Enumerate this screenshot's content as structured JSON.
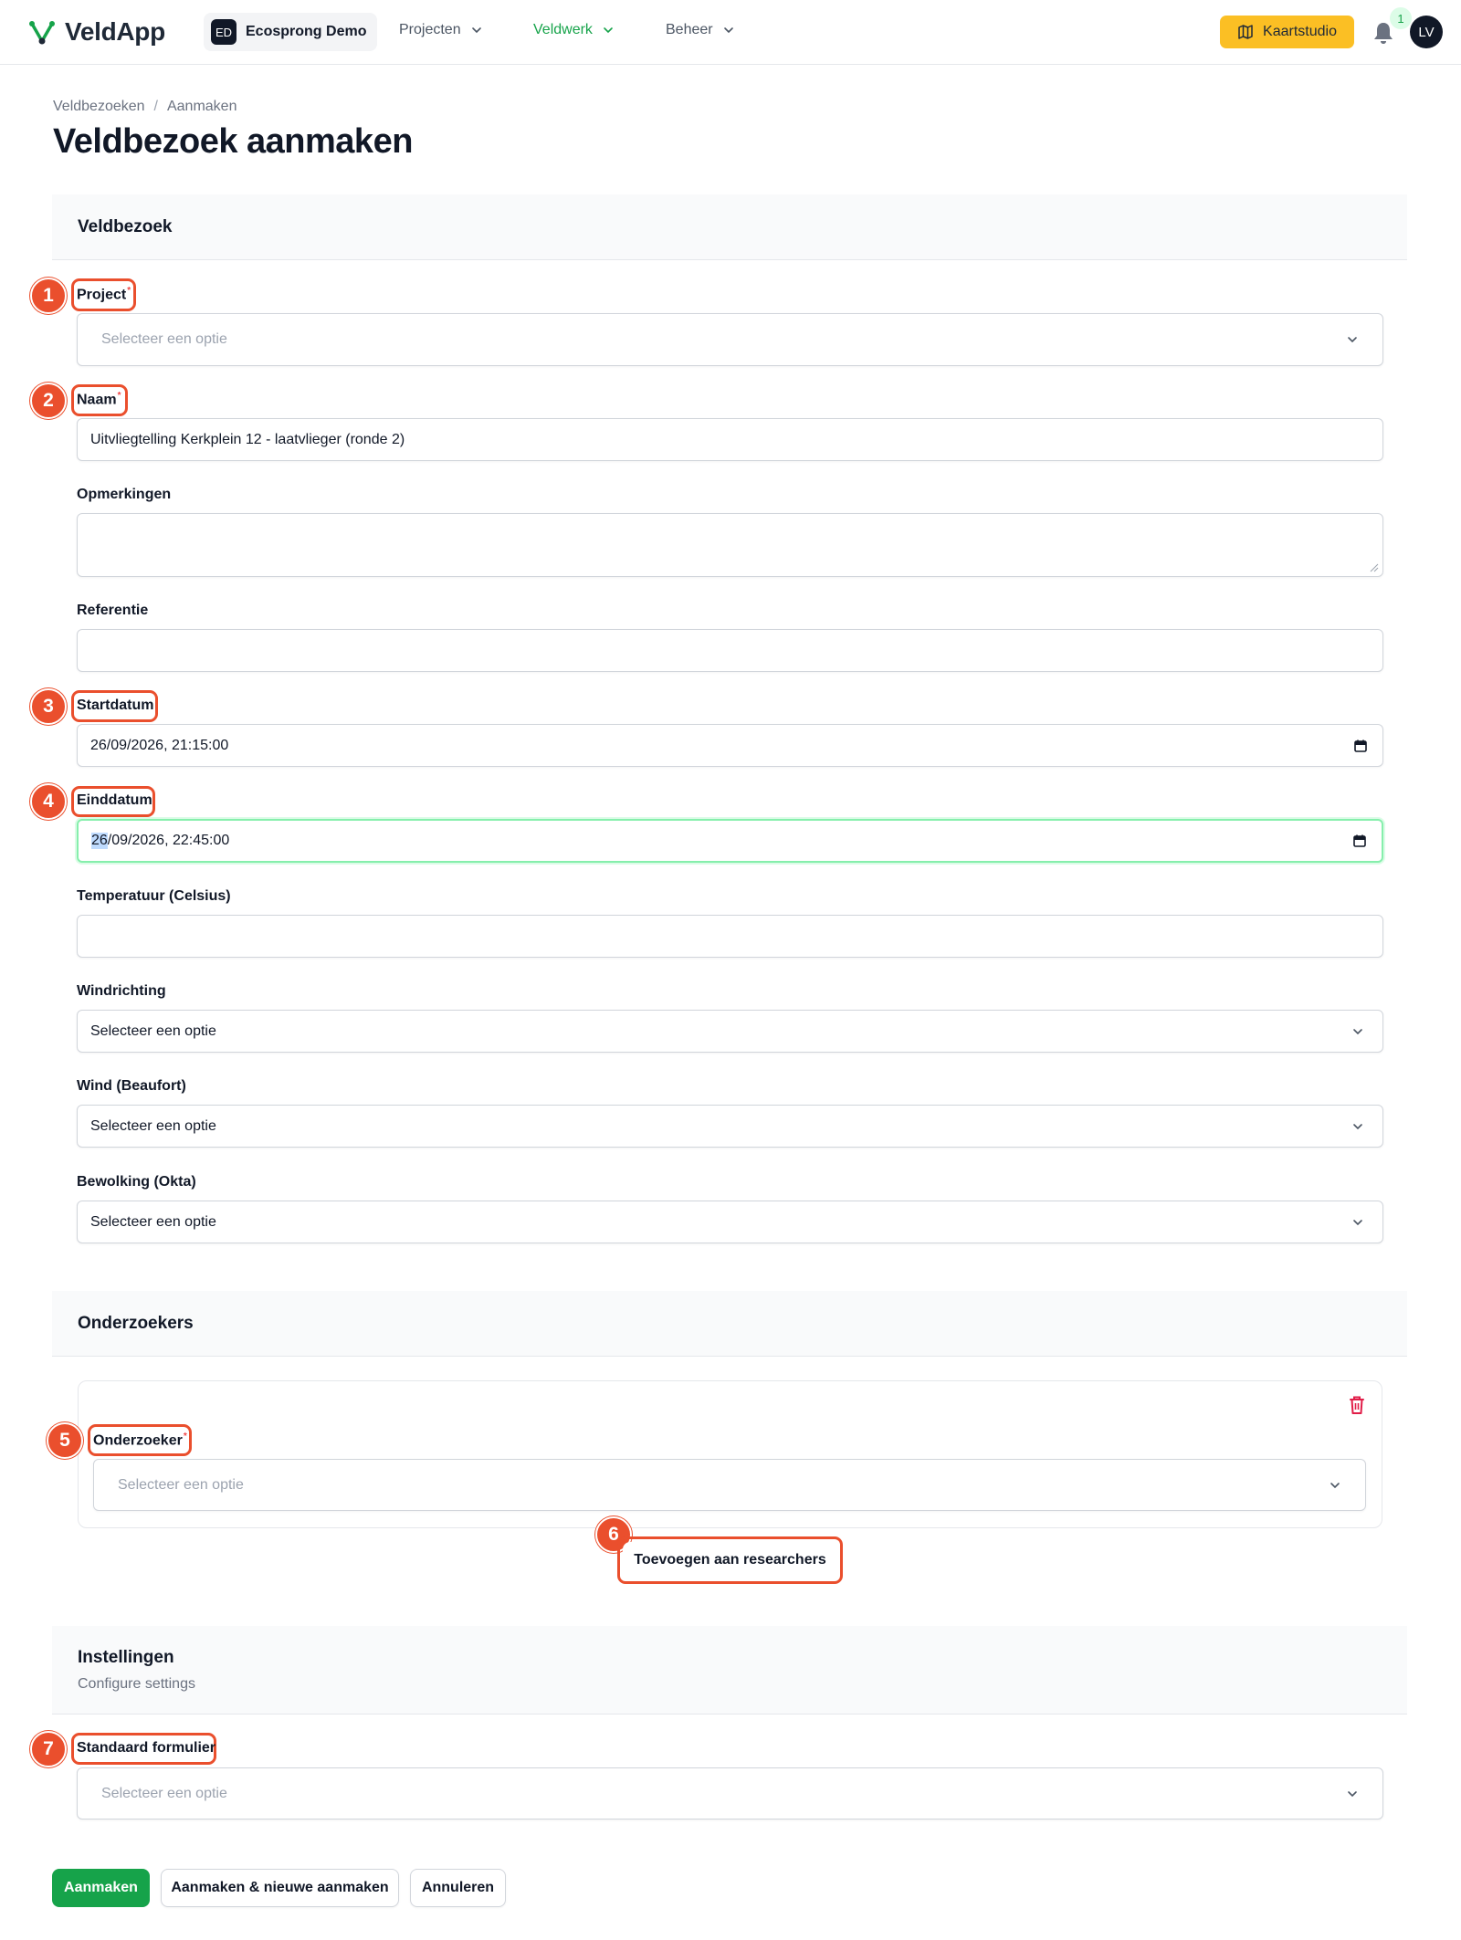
{
  "nav": {
    "app_name": "VeldApp",
    "tenant_badge": "ED",
    "tenant_name": "Ecosprong Demo",
    "items": [
      {
        "label": "Projecten"
      },
      {
        "label": "Veldwerk"
      },
      {
        "label": "Beheer"
      }
    ],
    "kaartstudio_label": "Kaartstudio",
    "notification_count": "1",
    "avatar_initials": "LV"
  },
  "breadcrumb": {
    "items": [
      "Veldbezoeken",
      "Aanmaken"
    ],
    "separator": "/"
  },
  "page_title": "Veldbezoek aanmaken",
  "sections": {
    "veldbezoek": {
      "title": "Veldbezoek"
    },
    "onderzoekers": {
      "title": "Onderzoekers"
    },
    "instellingen": {
      "title": "Instellingen",
      "description": "Configure settings"
    }
  },
  "fields": {
    "project": {
      "label": "Project",
      "placeholder": "Selecteer een optie"
    },
    "naam": {
      "label": "Naam",
      "value": "Uitvliegtelling Kerkplein 12 - laatvlieger (ronde 2)"
    },
    "opmerkingen": {
      "label": "Opmerkingen",
      "value": ""
    },
    "referentie": {
      "label": "Referentie",
      "value": ""
    },
    "startdatum": {
      "label": "Startdatum",
      "value": "26/09/2026, 21:15:00"
    },
    "einddatum": {
      "label": "Einddatum",
      "value_selected": "26",
      "value_rest": "/09/2026, 22:45:00"
    },
    "temperatuur": {
      "label": "Temperatuur (Celsius)",
      "value": ""
    },
    "windrichting": {
      "label": "Windrichting",
      "value": "Selecteer een optie"
    },
    "wind": {
      "label": "Wind (Beaufort)",
      "value": "Selecteer een optie"
    },
    "bewolking": {
      "label": "Bewolking (Okta)",
      "value": "Selecteer een optie"
    },
    "onderzoeker": {
      "label": "Onderzoeker",
      "placeholder": "Selecteer een optie"
    },
    "standaard_formulier": {
      "label": "Standaard formulier",
      "placeholder": "Selecteer een optie"
    }
  },
  "add_researcher_label": "Toevoegen aan researchers",
  "markers": [
    "1",
    "2",
    "3",
    "4",
    "5",
    "6",
    "7"
  ],
  "actions": {
    "create": "Aanmaken",
    "create_new": "Aanmaken & nieuwe aanmaken",
    "cancel": "Annuleren"
  },
  "colors": {
    "brand_green": "#16a34a",
    "accent_yellow": "#fbbf24",
    "annotation_orange": "#ea4f2d",
    "required_red": "#ef4444"
  }
}
